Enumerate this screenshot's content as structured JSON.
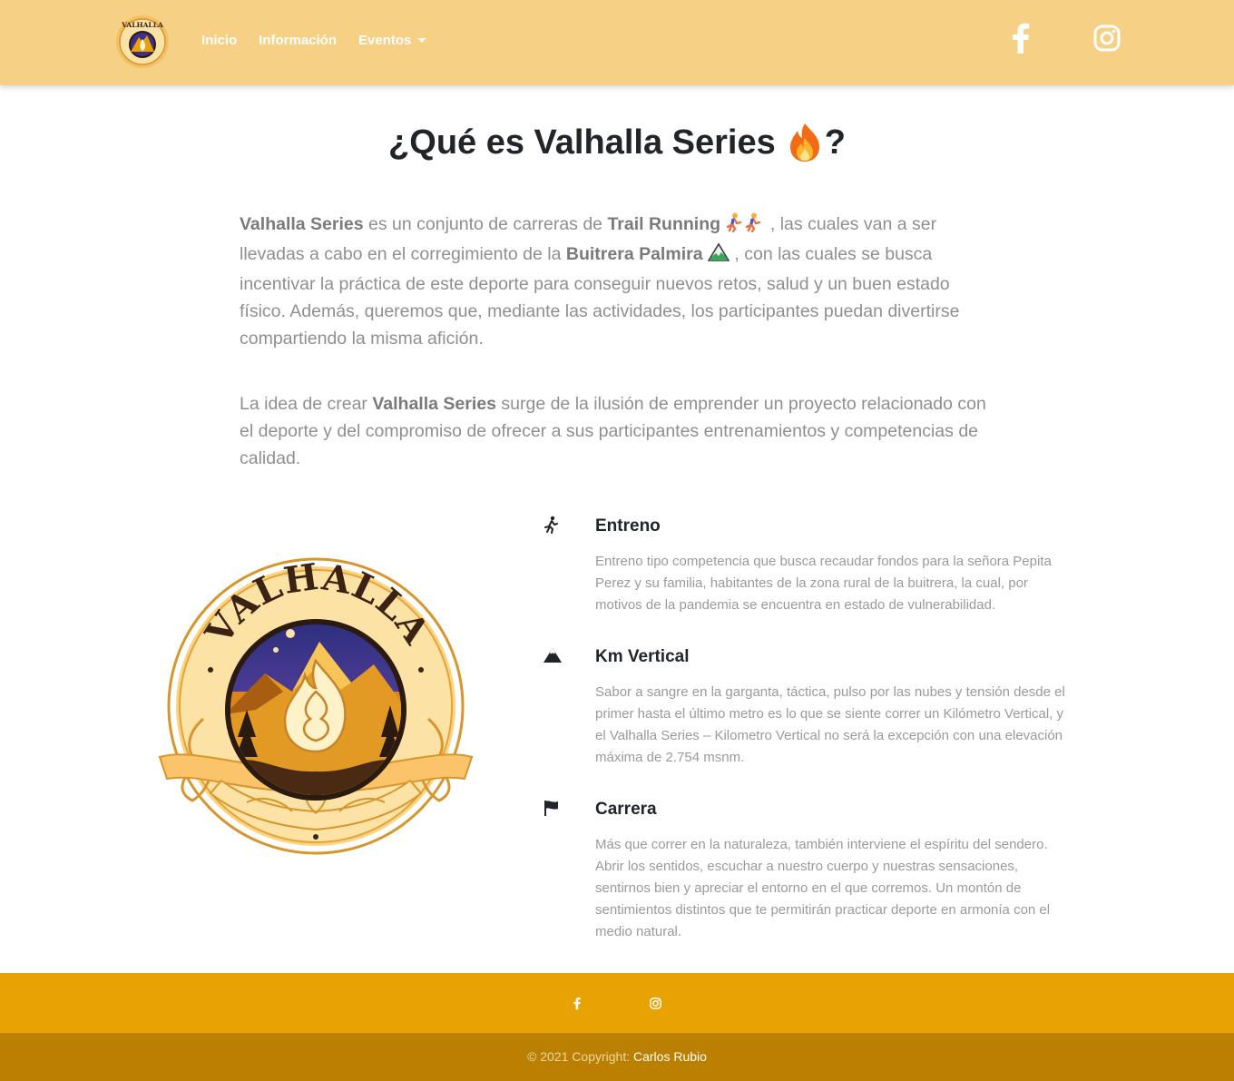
{
  "nav": {
    "links": [
      {
        "label": "Inicio"
      },
      {
        "label": "Información"
      },
      {
        "label": "Eventos"
      }
    ],
    "logo_text": "VALHALLA"
  },
  "main": {
    "title": "¿Qué es Valhalla Series",
    "title_suffix": "?",
    "intro1": {
      "s1": "Valhalla Series",
      "t1": " es un conjunto de carreras de ",
      "s2": "Trail Running",
      "t2": " , las cuales van a ser llevadas a cabo en el corregimiento de la ",
      "s3": "Buitrera Palmira",
      "t3": " , con las cuales se busca incentivar la práctica de este deporte para conseguir nuevos retos, salud y un buen estado físico. Además, queremos que, mediante las actividades, los participantes puedan divertirse compartiendo la misma afición."
    },
    "intro2": {
      "t1": "La idea de crear ",
      "s1": "Valhalla Series",
      "t2": " surge de la ilusión de emprender un proyecto relacionado con el deporte y del compromiso de ofrecer a sus participantes entrenamientos y competencias de calidad."
    },
    "logo_text": "VALHALLA"
  },
  "features": [
    {
      "icon": "running-icon",
      "title": "Entreno",
      "text": "Entreno tipo competencia que busca recaudar fondos para la señora Pepita Perez y su familia, habitantes de la zona rural de la buitrera, la cual, por motivos de la pandemia se encuentra en estado de vulnerabilidad."
    },
    {
      "icon": "mountain-icon",
      "title": "Km Vertical",
      "text": "Sabor a sangre en la garganta, táctica, pulso por las nubes y tensión desde el primer hasta el último metro es lo que se siente correr un Kilómetro Vertical, y el Valhalla Series – Kilometro Vertical no será la excepción con una elevación máxima de 2.754 msnm."
    },
    {
      "icon": "flag-icon",
      "title": "Carrera",
      "text": "Más que correr en la naturaleza, también interviene el espíritu del sendero. Abrir los sentidos, escuchar a nuestro cuerpo y nuestras sensaciones, sentirnos bien y apreciar el entorno en el que corremos. Un montón de sentimientos distintos que te permitirán practicar deporte en armonía con el medio natural."
    }
  ],
  "footer": {
    "copyright_prefix": "© 2021 Copyright: ",
    "copyright_link": "Carlos Rubio"
  },
  "colors": {
    "navbar": "#f5d085",
    "footer": "#e9a203",
    "copyright_bar": "#bb8002"
  }
}
